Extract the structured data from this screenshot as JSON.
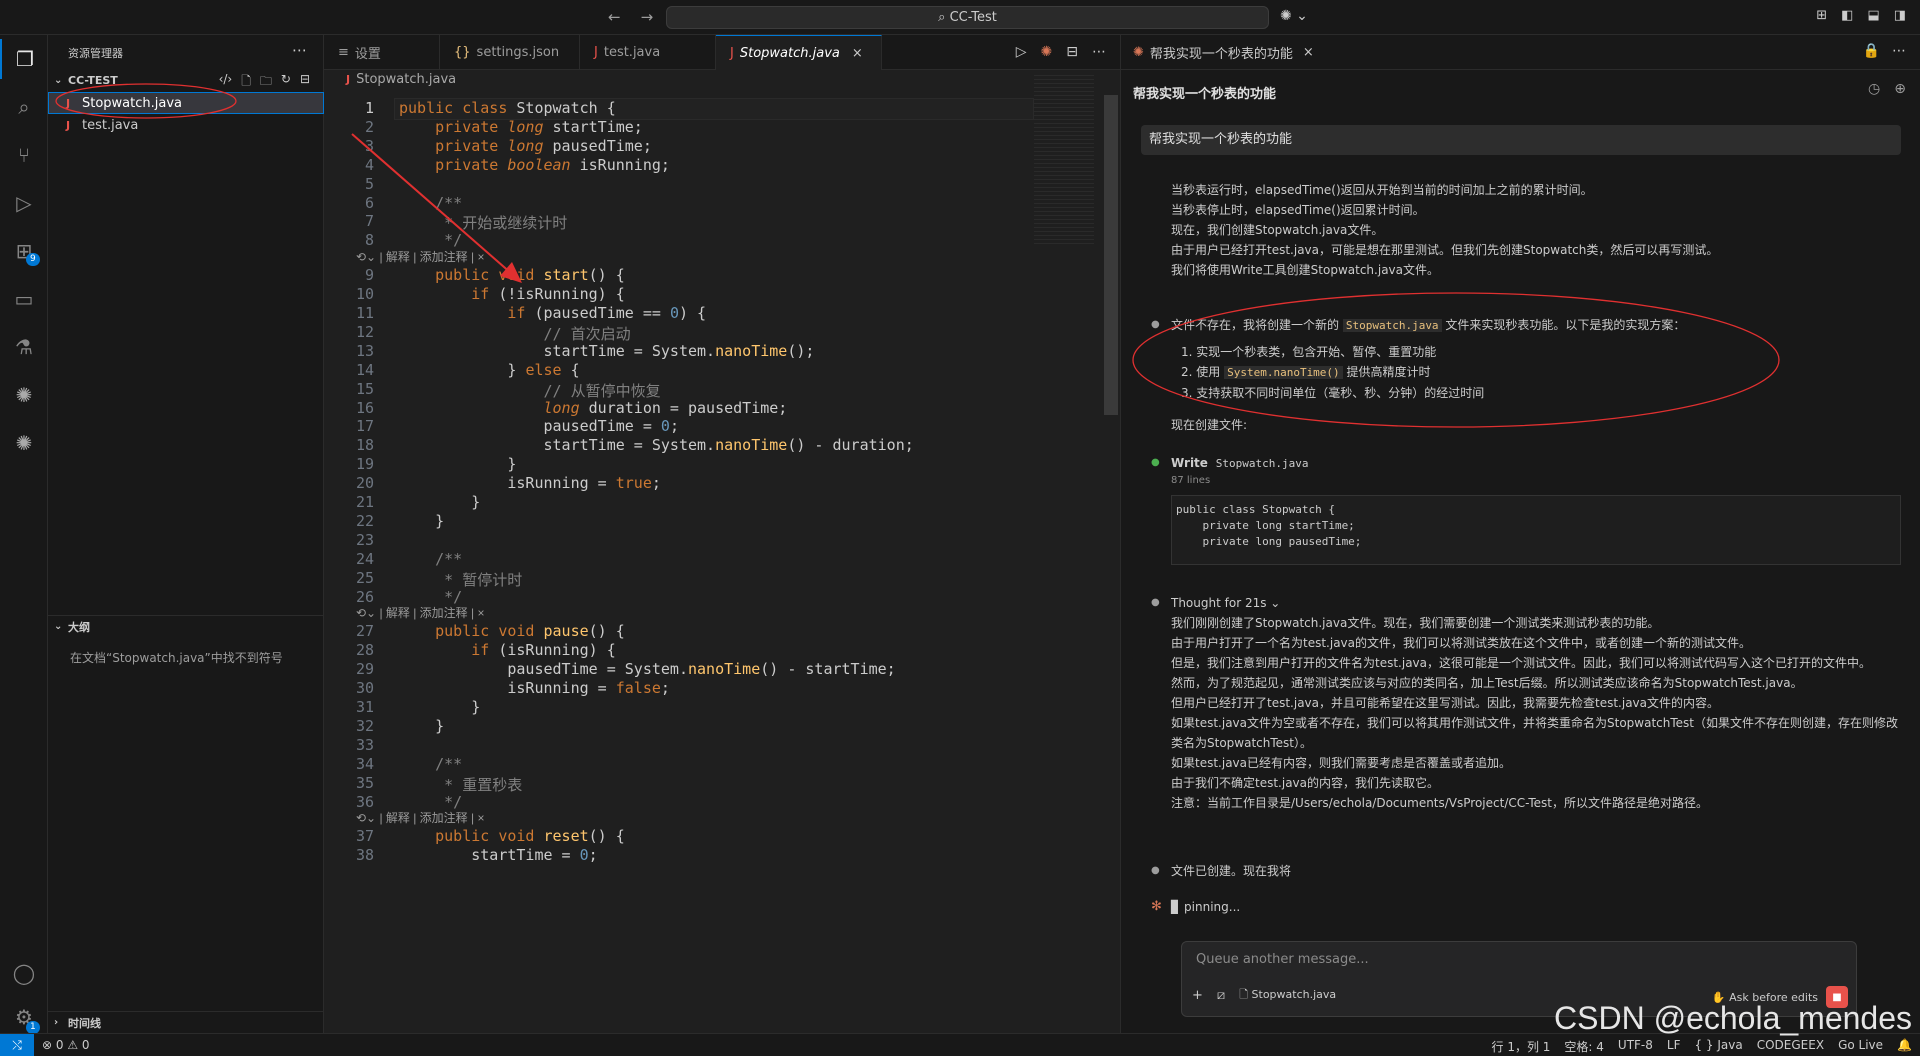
{
  "titlebar": {
    "search": "CC-Test",
    "back": "←",
    "forward": "→",
    "copilot": "✺"
  },
  "activity": {
    "extensions_badge": "9",
    "settings_badge": "1"
  },
  "explorer": {
    "title": "资源管理器",
    "folder": "CC-TEST",
    "files": [
      "Stopwatch.java",
      "test.java"
    ],
    "outline_title": "大纲",
    "outline_msg": "在文档“Stopwatch.java”中找不到符号",
    "timeline_title": "时间线"
  },
  "tabs": [
    {
      "label": "设置",
      "icon": "≡"
    },
    {
      "label": "settings.json",
      "icon": "{}"
    },
    {
      "label": "test.java",
      "icon": "J"
    },
    {
      "label": "Stopwatch.java",
      "icon": "J"
    }
  ],
  "breadcrumb": "Stopwatch.java",
  "codelens": "| 解释 | 添加注释 | ×",
  "code_lines": [
    {
      "n": "1",
      "t": "public class Stopwatch {"
    },
    {
      "n": "2",
      "t": "    private long startTime;"
    },
    {
      "n": "3",
      "t": "    private long pausedTime;"
    },
    {
      "n": "4",
      "t": "    private boolean isRunning;"
    },
    {
      "n": "5",
      "t": ""
    },
    {
      "n": "6",
      "t": "    /**"
    },
    {
      "n": "7",
      "t": "     * 开始或继续计时"
    },
    {
      "n": "8",
      "t": "     */"
    },
    {
      "n": "9",
      "t": "    public void start() {"
    },
    {
      "n": "10",
      "t": "        if (!isRunning) {"
    },
    {
      "n": "11",
      "t": "            if (pausedTime == 0) {"
    },
    {
      "n": "12",
      "t": "                // 首次启动"
    },
    {
      "n": "13",
      "t": "                startTime = System.nanoTime();"
    },
    {
      "n": "14",
      "t": "            } else {"
    },
    {
      "n": "15",
      "t": "                // 从暂停中恢复"
    },
    {
      "n": "16",
      "t": "                long duration = pausedTime;"
    },
    {
      "n": "17",
      "t": "                pausedTime = 0;"
    },
    {
      "n": "18",
      "t": "                startTime = System.nanoTime() - duration;"
    },
    {
      "n": "19",
      "t": "            }"
    },
    {
      "n": "20",
      "t": "            isRunning = true;"
    },
    {
      "n": "21",
      "t": "        }"
    },
    {
      "n": "22",
      "t": "    }"
    },
    {
      "n": "23",
      "t": ""
    },
    {
      "n": "24",
      "t": "    /**"
    },
    {
      "n": "25",
      "t": "     * 暂停计时"
    },
    {
      "n": "26",
      "t": "     */"
    },
    {
      "n": "27",
      "t": "    public void pause() {"
    },
    {
      "n": "28",
      "t": "        if (isRunning) {"
    },
    {
      "n": "29",
      "t": "            pausedTime = System.nanoTime() - startTime;"
    },
    {
      "n": "30",
      "t": "            isRunning = false;"
    },
    {
      "n": "31",
      "t": "        }"
    },
    {
      "n": "32",
      "t": "    }"
    },
    {
      "n": "33",
      "t": ""
    },
    {
      "n": "34",
      "t": "    /**"
    },
    {
      "n": "35",
      "t": "     * 重置秒表"
    },
    {
      "n": "36",
      "t": "     */"
    },
    {
      "n": "37",
      "t": "    public void reset() {"
    },
    {
      "n": "38",
      "t": "        startTime = 0;"
    }
  ],
  "chat": {
    "tab_title": "帮我实现一个秒表的功能",
    "header": "帮我实现一个秒表的功能",
    "user_msg": "帮我实现一个秒表的功能",
    "para1": [
      "当秒表运行时，elapsedTime()返回从开始到当前的时间加上之前的累计时间。",
      "当秒表停止时，elapsedTime()返回累计时间。",
      "现在，我们创建Stopwatch.java文件。",
      "由于用户已经打开test.java，可能是想在那里测试。但我们先创建Stopwatch类，然后可以再写测试。",
      "我们将使用Write工具创建Stopwatch.java文件。"
    ],
    "plan_pre": "文件不存在，我将创建一个新的",
    "plan_code": "Stopwatch.java",
    "plan_post": "文件来实现秒表功能。以下是我的实现方案：",
    "plan_items": [
      "1. 实现一个秒表类，包含开始、暂停、重置功能",
      "2. 使用",
      "提供高精度计时",
      "3. 支持获取不同时间单位（毫秒、秒、分钟）的经过时间"
    ],
    "plan_item2_code": "System.nanoTime()",
    "create_now": "现在创建文件:",
    "write_label": "Write",
    "write_file": "Stopwatch.java",
    "write_lines": "87 lines",
    "write_code": "public class Stopwatch {\n    private long startTime;\n    private long pausedTime;",
    "thought": "Thought for 21s",
    "thought_lines": [
      "我们刚刚创建了Stopwatch.java文件。现在，我们需要创建一个测试类来测试秒表的功能。",
      "由于用户打开了一个名为test.java的文件，我们可以将测试类放在这个文件中，或者创建一个新的测试文件。",
      "但是，我们注意到用户打开的文件名为test.java，这很可能是一个测试文件。因此，我们可以将测试代码写入这个已打开的文件中。",
      "然而，为了规范起见，通常测试类应该与对应的类同名，加上Test后缀。所以测试类应该命名为StopwatchTest.java。",
      "但用户已经打开了test.java，并且可能希望在这里写测试。因此，我需要先检查test.java文件的内容。",
      "如果test.java文件为空或者不存在，我们可以将其用作测试文件，并将类重命名为StopwatchTest（如果文件不存在则创建，存在则修改类名为StopwatchTest）。",
      "如果test.java已经有内容，则我们需要考虑是否覆盖或者追加。",
      "由于我们不确定test.java的内容，我们先读取它。",
      "注意：当前工作目录是/Users/echola/Documents/VsProject/CC-Test，所以文件路径是绝对路径。"
    ],
    "created": "文件已创建。现在我将",
    "spinning": "pinning...",
    "input_placeholder": "Queue another message...",
    "attached_file": "Stopwatch.java",
    "ask_before": "Ask before edits"
  },
  "status": {
    "problems": "⊗ 0 ⚠ 0",
    "position": "行 1，列 1",
    "spaces": "空格: 4",
    "encoding": "UTF-8",
    "eol": "LF",
    "lang": "{ } Java",
    "codegeex": "CODEGEEX",
    "golive": "Go Live"
  },
  "watermark": "CSDN @echola_mendes",
  "colors": {
    "accent": "#0078d4",
    "keyword": "#cc7832",
    "annotation": "#e03030"
  }
}
